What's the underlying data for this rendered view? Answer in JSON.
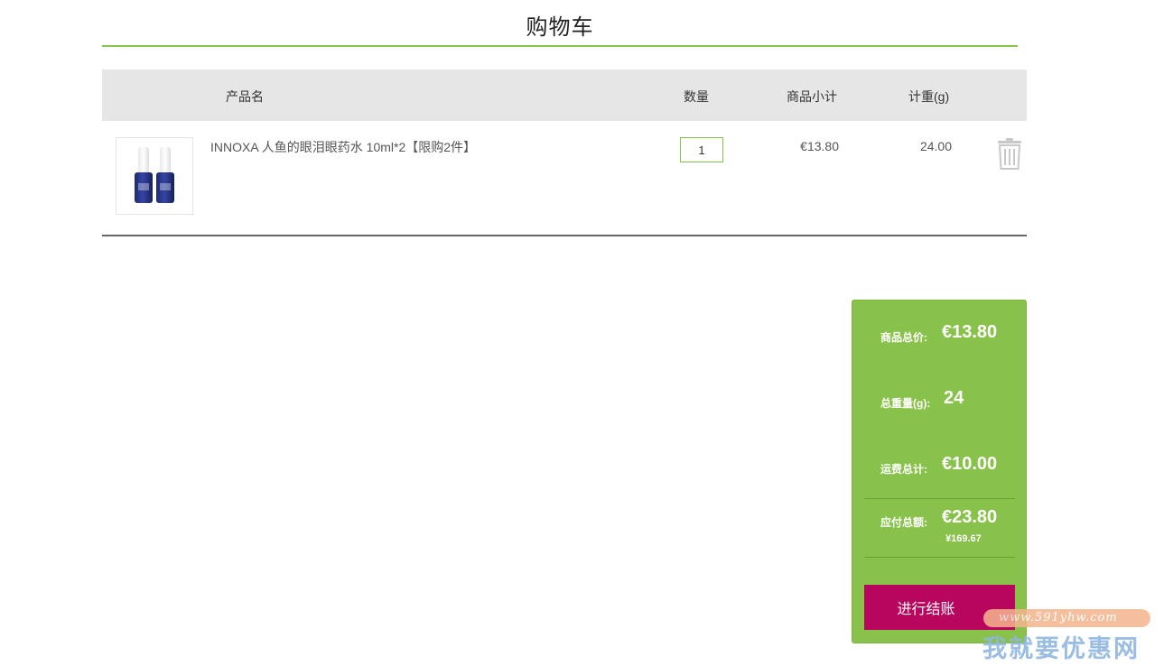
{
  "page": {
    "title": "购物车"
  },
  "table": {
    "headers": {
      "name": "产品名",
      "qty": "数量",
      "subtotal": "商品小计",
      "weight": "计重(g)"
    }
  },
  "items": [
    {
      "name": "INNOXA 人鱼的眼泪眼药水 10ml*2【限购2件】",
      "qty": "1",
      "subtotal": "€13.80",
      "weight": "24.00"
    }
  ],
  "summary": {
    "total_label": "商品总价:",
    "total_value": "€13.80",
    "weight_label": "总重量(g):",
    "weight_value": "24",
    "shipping_label": "运费总计:",
    "shipping_value": "€10.00",
    "payable_label": "应付总额:",
    "payable_value": "€23.80",
    "payable_rmb": "¥169.67",
    "checkout_label": "进行结账"
  },
  "watermark": {
    "url": "www.591yhw.com",
    "text": "我就要优惠网"
  },
  "colors": {
    "accent": "#88c24a",
    "checkout": "#b8065e",
    "header_bg": "#e6e6e6"
  }
}
